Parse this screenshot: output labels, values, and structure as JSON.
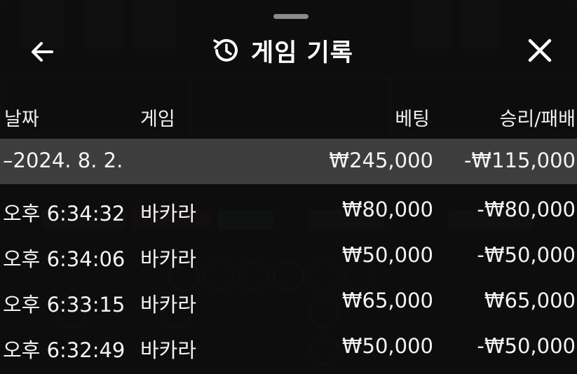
{
  "header": {
    "title": "게임 기록",
    "icons": {
      "back": "arrow-left-icon",
      "history": "history-icon",
      "close": "close-icon"
    }
  },
  "columns": {
    "date": "날짜",
    "game": "게임",
    "bet": "베팅",
    "result": "승리/패배"
  },
  "date_group": {
    "label": "–2024. 8. 2.",
    "bet": "₩245,000",
    "result": "-₩115,000"
  },
  "rows": [
    {
      "time": "오후 6:34:32",
      "game": "바카라",
      "bet": "₩80,000",
      "result": "-₩80,000"
    },
    {
      "time": "오후 6:34:06",
      "game": "바카라",
      "bet": "₩50,000",
      "result": "-₩50,000"
    },
    {
      "time": "오후 6:33:15",
      "game": "바카라",
      "bet": "₩65,000",
      "result": "₩65,000"
    },
    {
      "time": "오후 6:32:49",
      "game": "바카라",
      "bet": "₩50,000",
      "result": "-₩50,000"
    }
  ],
  "colors": {
    "sheet": "#0f0f0f",
    "date_row": "#3d3d3d",
    "text": "#f2f2f2"
  }
}
